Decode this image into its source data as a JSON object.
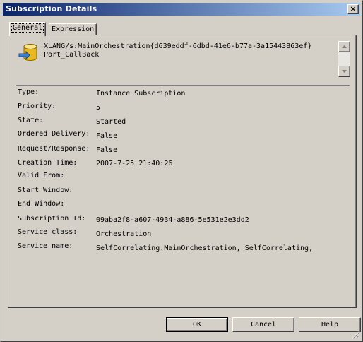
{
  "window": {
    "title": "Subscription Details",
    "close_glyph": "×"
  },
  "tabs": [
    {
      "label": "General",
      "active": true
    },
    {
      "label": "Expression",
      "active": false
    }
  ],
  "header": {
    "icon": "orchestration-database-icon",
    "line1": "XLANG/s:MainOrchestration{d639eddf-6dbd-41e6-b77a-3a15443863ef}",
    "line2": "Port_CallBack"
  },
  "properties": [
    {
      "label": "Type:",
      "value": "Instance Subscription"
    },
    {
      "label": "Priority:",
      "value": "5"
    },
    {
      "label": "State:",
      "value": "Started"
    },
    {
      "label": "Ordered Delivery:",
      "value": "False"
    },
    {
      "label": "Request/Response:",
      "value": "False"
    },
    {
      "label": "Creation Time:",
      "value": "2007-7-25 21:40:26"
    },
    {
      "label": "Valid From:",
      "value": ""
    },
    {
      "label": "Start Window:",
      "value": ""
    },
    {
      "label": "End Window:",
      "value": ""
    },
    {
      "label": "Subscription Id:",
      "value": "09aba2f8-a607-4934-a886-5e531e2e3dd2"
    },
    {
      "label": "Service class:",
      "value": "Orchestration"
    },
    {
      "label": "Service name:",
      "value": "SelfCorrelating.MainOrchestration, SelfCorrelating,"
    }
  ],
  "buttons": {
    "ok": "OK",
    "cancel": "Cancel",
    "help": "Help"
  },
  "colors": {
    "title_start": "#0a246a",
    "title_end": "#a6caf0",
    "face": "#d4d0c8"
  }
}
